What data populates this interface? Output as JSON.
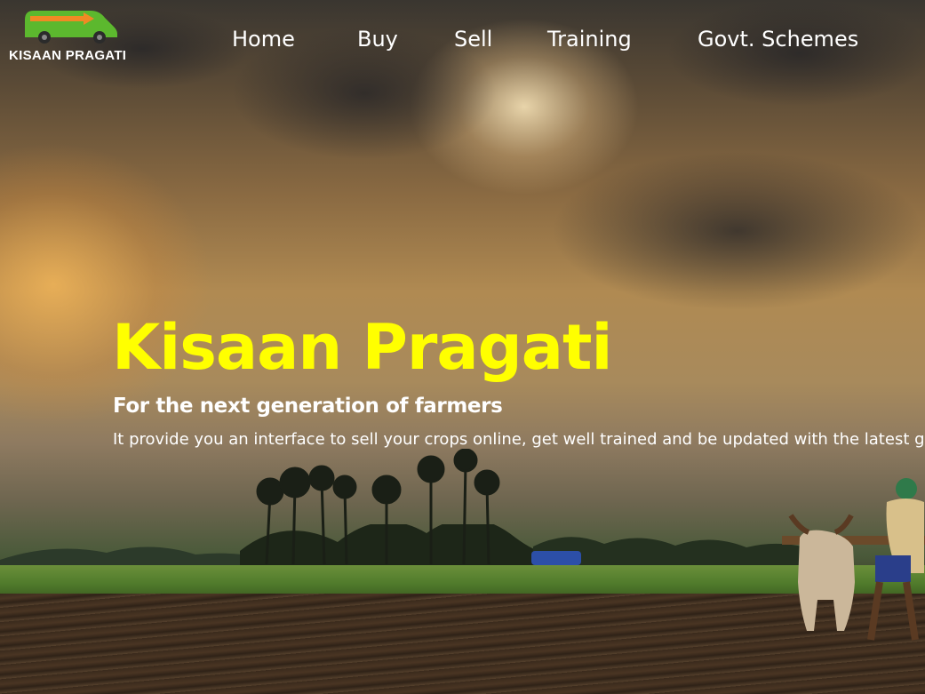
{
  "brand": {
    "name": "KISAAN PRAGATI"
  },
  "nav": {
    "items": [
      {
        "label": "Home"
      },
      {
        "label": "Buy"
      },
      {
        "label": "Sell"
      },
      {
        "label": "Training"
      },
      {
        "label": "Govt. Schemes"
      }
    ]
  },
  "hero": {
    "title": "Kisaan Pragati",
    "subtitle": "For the next generation of farmers",
    "description": "It provide you an interface to sell your crops online, get well trained and be updated with the latest government schemes.",
    "background_icon": "farm-landscape-image"
  },
  "colors": {
    "title": "#ffff00",
    "logo_green": "#5cb82e",
    "logo_orange": "#f08a24"
  }
}
